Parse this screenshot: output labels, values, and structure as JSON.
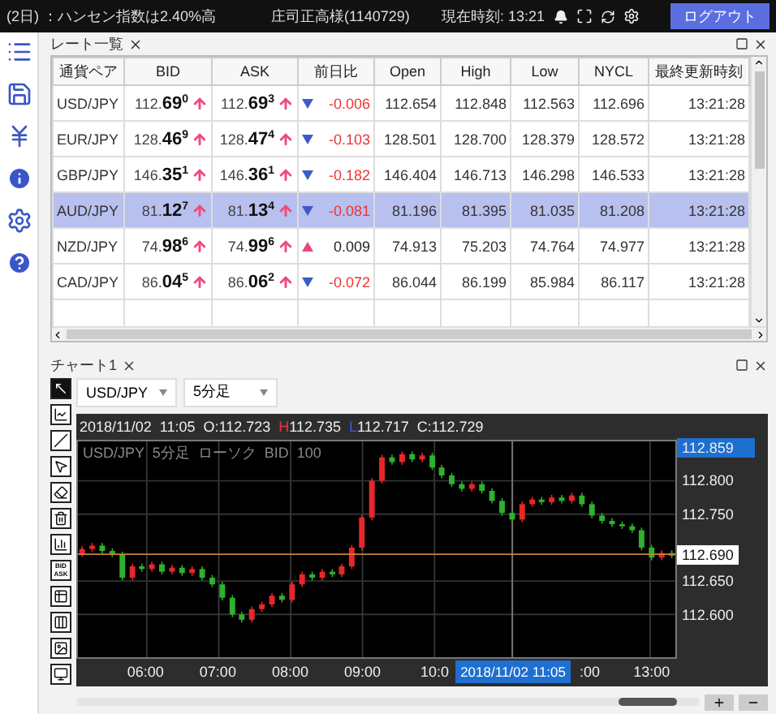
{
  "top_bar": {
    "news": "(2日) ：ハンセン指数は2.40%高",
    "user": "庄司正高様(1140729)",
    "clock": "現在時刻: 13:21",
    "logout": "ログアウト"
  },
  "rate_panel": {
    "tab": "レート一覧",
    "columns": [
      "通貨ペア",
      "BID",
      "ASK",
      "前日比",
      "Open",
      "High",
      "Low",
      "NYCL",
      "最終更新時刻"
    ],
    "rows": [
      {
        "pair": "USD/JPY",
        "bid": "112.**69**$^{0}$",
        "bid_up": true,
        "ask": "112.**69**$^{3}$",
        "ask_up": true,
        "change_up": false,
        "change": "-0.006",
        "open": "112.654",
        "high": "112.848",
        "low": "112.563",
        "nycl": "112.696",
        "time": "13:21:28",
        "selected": false
      },
      {
        "pair": "EUR/JPY",
        "bid": "128.**46**$^{9}$",
        "bid_up": true,
        "ask": "128.**47**$^{4}$",
        "ask_up": true,
        "change_up": false,
        "change": "-0.103",
        "open": "128.501",
        "high": "128.700",
        "low": "128.379",
        "nycl": "128.572",
        "time": "13:21:28",
        "selected": false
      },
      {
        "pair": "GBP/JPY",
        "bid": "146.**35**$^{1}$",
        "bid_up": true,
        "ask": "146.**36**$^{1}$",
        "ask_up": true,
        "change_up": false,
        "change": "-0.182",
        "open": "146.404",
        "high": "146.713",
        "low": "146.298",
        "nycl": "146.533",
        "time": "13:21:28",
        "selected": false
      },
      {
        "pair": "AUD/JPY",
        "bid": "81.**12**$^{7}$",
        "bid_up": true,
        "ask": "81.**13**$^{4}$",
        "ask_up": true,
        "change_up": false,
        "change": "-0.081",
        "open": "81.196",
        "high": "81.395",
        "low": "81.035",
        "nycl": "81.208",
        "time": "13:21:28",
        "selected": true
      },
      {
        "pair": "NZD/JPY",
        "bid": "74.**98**$^{6}$",
        "bid_up": true,
        "ask": "74.**99**$^{6}$",
        "ask_up": true,
        "change_up": true,
        "change": "0.009",
        "open": "74.913",
        "high": "75.203",
        "low": "74.764",
        "nycl": "74.977",
        "time": "13:21:28",
        "selected": false
      },
      {
        "pair": "CAD/JPY",
        "bid": "86.**04**$^{5}$",
        "bid_up": true,
        "ask": "86.**06**$^{2}$",
        "ask_up": true,
        "change_up": false,
        "change": "-0.072",
        "open": "86.044",
        "high": "86.199",
        "low": "85.984",
        "nycl": "86.117",
        "time": "13:21:28",
        "selected": false
      }
    ]
  },
  "chart_panel": {
    "tab": "チャート1",
    "symbol": "USD/JPY",
    "period": "5分足",
    "tools": [
      {
        "kind": "icon"
      },
      {
        "kind": "icon"
      },
      {
        "kind": "icon"
      },
      {
        "kind": "icon"
      },
      {
        "kind": "icon"
      },
      {
        "kind": "icon"
      },
      {
        "kind": "icon"
      },
      {
        "kind": "text",
        "top": "BID",
        "bottom": "ASK"
      },
      {
        "kind": "icon"
      },
      {
        "kind": "icon"
      },
      {
        "kind": "icon"
      },
      {
        "kind": "icon"
      }
    ],
    "info": {
      "date": "2018/11/02",
      "time": "11:05",
      "open": "O:112.723",
      "high_label": "H",
      "high": "112.735",
      "low_label": "L",
      "low": "112.717",
      "close": "C:112.729"
    },
    "subtitle": "USD/JPY  5分足  ローソク  BID  100",
    "crosshair": "2018/11/02 11:05",
    "current_price": "112.859",
    "last_price": "112.690",
    "cut_time_label": ":00",
    "chart_data": {
      "type": "candlestick",
      "ylim": [
        112.536,
        112.859
      ],
      "yticks": [
        {
          "value": 112.8,
          "label": "112.800"
        },
        {
          "value": 112.75,
          "label": "112.750"
        },
        {
          "value": 112.65,
          "label": "112.650"
        },
        {
          "value": 112.6,
          "label": "112.600"
        }
      ],
      "xlim": [
        5.042,
        13.35
      ],
      "xticks": [
        {
          "value": 6,
          "label": "06:00"
        },
        {
          "value": 7,
          "label": "07:00"
        },
        {
          "value": 8,
          "label": "08:00"
        },
        {
          "value": 9,
          "label": "09:00"
        },
        {
          "value": 10,
          "label": "10:0"
        },
        {
          "value": 13,
          "label": "13:00"
        }
      ],
      "grid": true,
      "ref_lines": [
        {
          "axis": "y",
          "value": 112.69
        },
        {
          "axis": "x",
          "value": 11.083
        }
      ],
      "x": [
        5.1,
        5.24,
        5.38,
        5.52,
        5.66,
        5.8,
        5.93,
        6.07,
        6.21,
        6.35,
        6.49,
        6.63,
        6.77,
        6.91,
        7.05,
        7.19,
        7.32,
        7.46,
        7.6,
        7.74,
        7.88,
        8.02,
        8.16,
        8.3,
        8.44,
        8.58,
        8.71,
        8.85,
        8.99,
        9.13,
        9.27,
        9.41,
        9.55,
        9.69,
        9.83,
        9.97,
        10.1,
        10.24,
        10.38,
        10.52,
        10.66,
        10.8,
        10.94,
        11.08,
        11.22,
        11.36,
        11.49,
        11.63,
        11.77,
        11.91,
        12.05,
        12.19,
        12.33,
        12.47,
        12.61,
        12.75,
        12.88,
        13.02,
        13.16,
        13.3
      ],
      "ohlc": [
        [
          112.69,
          112.702,
          112.686,
          112.698
        ],
        [
          112.698,
          112.707,
          112.694,
          112.703
        ],
        [
          112.703,
          112.707,
          112.691,
          112.695
        ],
        [
          112.695,
          112.699,
          112.686,
          112.69
        ],
        [
          112.69,
          112.694,
          112.651,
          112.655
        ],
        [
          112.655,
          112.676,
          112.651,
          112.672
        ],
        [
          112.672,
          112.676,
          112.664,
          112.668
        ],
        [
          112.668,
          112.679,
          112.664,
          112.675
        ],
        [
          112.675,
          112.679,
          112.66,
          112.664
        ],
        [
          112.664,
          112.674,
          112.66,
          112.67
        ],
        [
          112.67,
          112.674,
          112.658,
          112.662
        ],
        [
          112.662,
          112.672,
          112.658,
          112.668
        ],
        [
          112.668,
          112.672,
          112.651,
          112.655
        ],
        [
          112.655,
          112.659,
          112.641,
          112.645
        ],
        [
          112.645,
          112.649,
          112.621,
          112.625
        ],
        [
          112.625,
          112.629,
          112.596,
          112.6
        ],
        [
          112.6,
          112.604,
          112.588,
          112.592
        ],
        [
          112.592,
          112.612,
          112.588,
          112.608
        ],
        [
          112.608,
          112.619,
          112.604,
          112.615
        ],
        [
          112.615,
          112.632,
          112.611,
          112.628
        ],
        [
          112.628,
          112.632,
          112.618,
          112.622
        ],
        [
          112.622,
          112.649,
          112.618,
          112.645
        ],
        [
          112.645,
          112.664,
          112.641,
          112.66
        ],
        [
          112.66,
          112.664,
          112.651,
          112.655
        ],
        [
          112.655,
          112.668,
          112.651,
          112.664
        ],
        [
          112.664,
          112.668,
          112.656,
          112.66
        ],
        [
          112.66,
          112.676,
          112.656,
          112.672
        ],
        [
          112.672,
          112.704,
          112.668,
          112.7
        ],
        [
          112.7,
          112.749,
          112.696,
          112.745
        ],
        [
          112.745,
          112.804,
          112.741,
          112.8
        ],
        [
          112.8,
          112.839,
          112.796,
          112.835
        ],
        [
          112.835,
          112.839,
          112.824,
          112.828
        ],
        [
          112.828,
          112.844,
          112.824,
          112.84
        ],
        [
          112.84,
          112.844,
          112.828,
          112.832
        ],
        [
          112.832,
          112.842,
          112.828,
          112.838
        ],
        [
          112.838,
          112.842,
          112.816,
          112.82
        ],
        [
          112.82,
          112.824,
          112.804,
          112.808
        ],
        [
          112.808,
          112.812,
          112.791,
          112.795
        ],
        [
          112.795,
          112.799,
          112.784,
          112.788
        ],
        [
          112.788,
          112.799,
          112.784,
          112.795
        ],
        [
          112.795,
          112.799,
          112.781,
          112.785
        ],
        [
          112.785,
          112.789,
          112.766,
          112.77
        ],
        [
          112.77,
          112.774,
          112.748,
          112.752
        ],
        [
          112.752,
          112.756,
          112.738,
          112.742
        ],
        [
          112.742,
          112.769,
          112.738,
          112.765
        ],
        [
          112.765,
          112.776,
          112.761,
          112.772
        ],
        [
          112.772,
          112.776,
          112.764,
          112.768
        ],
        [
          112.768,
          112.779,
          112.764,
          112.775
        ],
        [
          112.775,
          112.779,
          112.766,
          112.77
        ],
        [
          112.77,
          112.782,
          112.766,
          112.778
        ],
        [
          112.778,
          112.782,
          112.761,
          112.765
        ],
        [
          112.765,
          112.769,
          112.744,
          112.748
        ],
        [
          112.748,
          112.752,
          112.736,
          112.74
        ],
        [
          112.74,
          112.744,
          112.731,
          112.735
        ],
        [
          112.735,
          112.739,
          112.728,
          112.732
        ],
        [
          112.732,
          112.736,
          112.722,
          112.726
        ],
        [
          112.726,
          112.73,
          112.696,
          112.7
        ],
        [
          112.7,
          112.704,
          112.681,
          112.685
        ],
        [
          112.685,
          112.696,
          112.681,
          112.692
        ],
        [
          112.692,
          112.696,
          112.684,
          112.688
        ]
      ]
    }
  }
}
